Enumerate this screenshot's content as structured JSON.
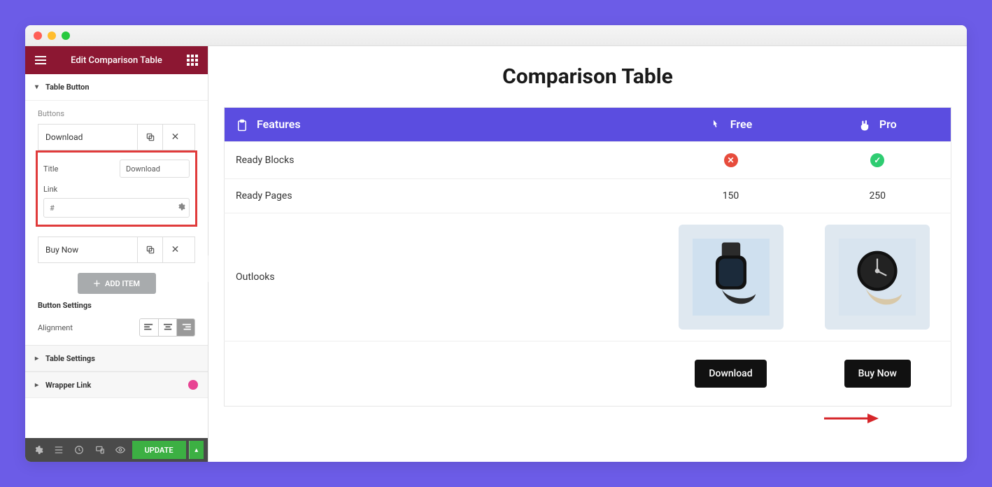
{
  "header": {
    "title": "Edit Comparison Table"
  },
  "sections": {
    "table_button": "Table Button",
    "buttons_label": "Buttons",
    "table_settings": "Table Settings",
    "wrapper_link": "Wrapper Link"
  },
  "buttons": [
    {
      "name": "Download"
    },
    {
      "name": "Buy Now"
    }
  ],
  "fields": {
    "title_label": "Title",
    "title_value": "Download",
    "link_label": "Link",
    "link_placeholder": "#"
  },
  "add_item": "ADD ITEM",
  "button_settings": {
    "heading": "Button Settings",
    "alignment_label": "Alignment"
  },
  "footer": {
    "update": "UPDATE"
  },
  "preview": {
    "title": "Comparison Table",
    "columns": {
      "features": "Features",
      "free": "Free",
      "pro": "Pro"
    },
    "rows": {
      "ready_blocks": "Ready Blocks",
      "ready_pages": "Ready Pages",
      "ready_pages_free": "150",
      "ready_pages_pro": "250",
      "outlooks": "Outlooks"
    },
    "cta": {
      "download": "Download",
      "buy_now": "Buy Now"
    }
  }
}
